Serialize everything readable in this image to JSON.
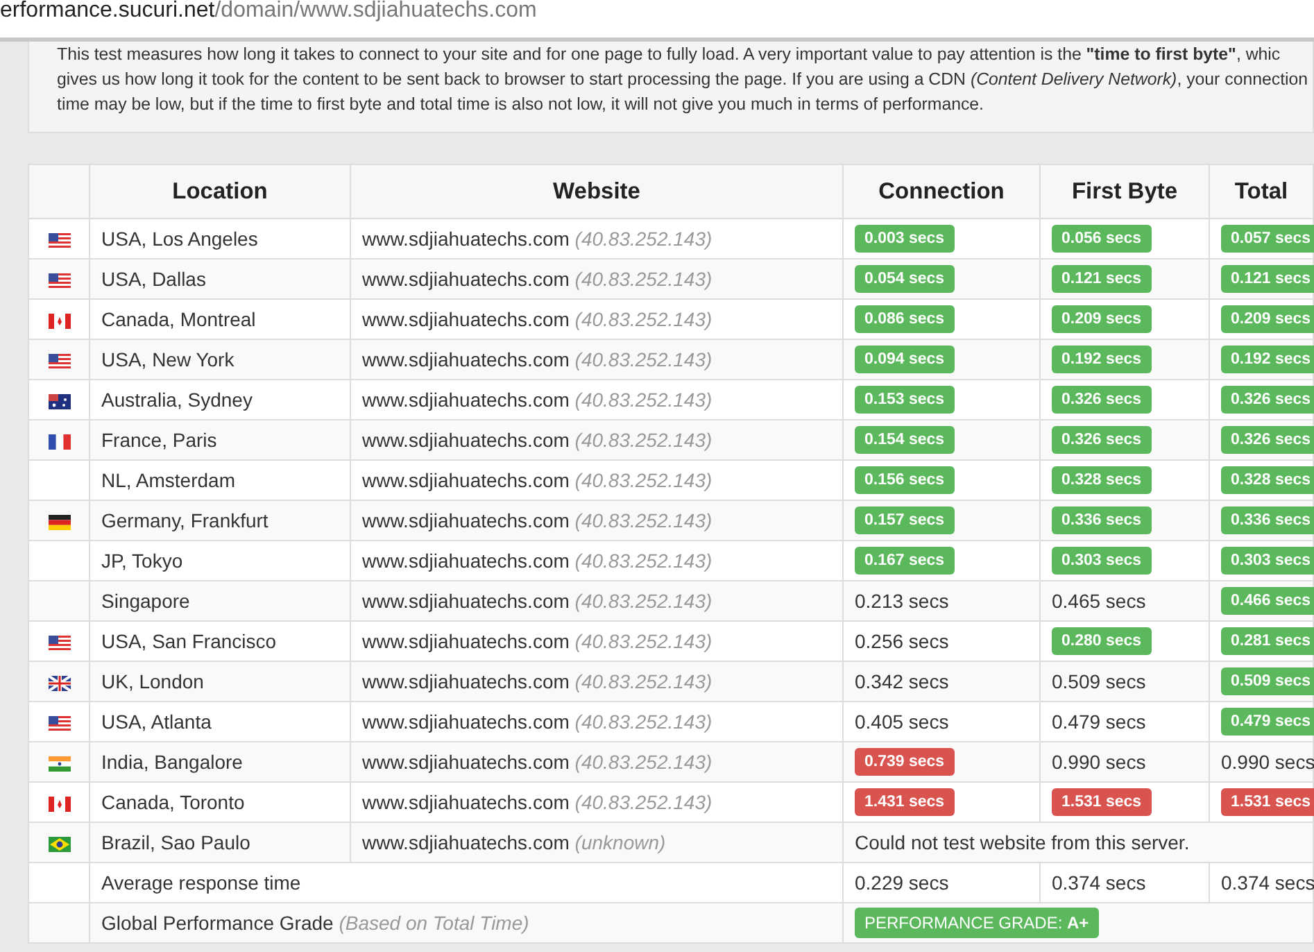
{
  "address_bar": {
    "host": "erformance.sucuri.net",
    "path": "/domain/www.sdjiahuatechs.com"
  },
  "description": "This test measures how long it takes to connect to your site and for one page to fully load. A very important value to pay attention is the **\"time to first byte\"**, whic gives us how long it took for the content to be sent back to browser to start processing the page. If you are using a CDN *(Content Delivery Network)*, your connection time may be low, but if the time to first byte and total time is also not low, it will not give you much in terms of performance.",
  "table": {
    "columns": [
      "Location",
      "Website",
      "Connection",
      "First Byte",
      "Total"
    ],
    "rows": [
      {
        "flag": {
          "kind": "us"
        },
        "location": "USA, Los Angeles",
        "website": "www.sdjiahuatechs.com",
        "ip": "(40.83.252.143)",
        "times": [
          {
            "value": "0.003 secs",
            "kind": "good"
          },
          {
            "value": "0.056 secs",
            "kind": "good"
          },
          {
            "value": "0.057 secs",
            "kind": "good"
          }
        ]
      },
      {
        "flag": {
          "kind": "us"
        },
        "location": "USA, Dallas",
        "website": "www.sdjiahuatechs.com",
        "ip": "(40.83.252.143)",
        "times": [
          {
            "value": "0.054 secs",
            "kind": "good"
          },
          {
            "value": "0.121 secs",
            "kind": "good"
          },
          {
            "value": "0.121 secs",
            "kind": "good"
          }
        ]
      },
      {
        "flag": {
          "kind": "ca"
        },
        "location": "Canada, Montreal",
        "website": "www.sdjiahuatechs.com",
        "ip": "(40.83.252.143)",
        "times": [
          {
            "value": "0.086 secs",
            "kind": "good"
          },
          {
            "value": "0.209 secs",
            "kind": "good"
          },
          {
            "value": "0.209 secs",
            "kind": "good"
          }
        ]
      },
      {
        "flag": {
          "kind": "us"
        },
        "location": "USA, New York",
        "website": "www.sdjiahuatechs.com",
        "ip": "(40.83.252.143)",
        "times": [
          {
            "value": "0.094 secs",
            "kind": "good"
          },
          {
            "value": "0.192 secs",
            "kind": "good"
          },
          {
            "value": "0.192 secs",
            "kind": "good"
          }
        ]
      },
      {
        "flag": {
          "kind": "au"
        },
        "location": "Australia, Sydney",
        "website": "www.sdjiahuatechs.com",
        "ip": "(40.83.252.143)",
        "times": [
          {
            "value": "0.153 secs",
            "kind": "good"
          },
          {
            "value": "0.326 secs",
            "kind": "good"
          },
          {
            "value": "0.326 secs",
            "kind": "good"
          }
        ]
      },
      {
        "flag": {
          "kind": "fr"
        },
        "location": "France, Paris",
        "website": "www.sdjiahuatechs.com",
        "ip": "(40.83.252.143)",
        "times": [
          {
            "value": "0.154 secs",
            "kind": "good"
          },
          {
            "value": "0.326 secs",
            "kind": "good"
          },
          {
            "value": "0.326 secs",
            "kind": "good"
          }
        ]
      },
      {
        "location": "NL, Amsterdam",
        "website": "www.sdjiahuatechs.com",
        "ip": "(40.83.252.143)",
        "times": [
          {
            "value": "0.156 secs",
            "kind": "good"
          },
          {
            "value": "0.328 secs",
            "kind": "good"
          },
          {
            "value": "0.328 secs",
            "kind": "good"
          }
        ]
      },
      {
        "flag": {
          "kind": "de"
        },
        "location": "Germany, Frankfurt",
        "website": "www.sdjiahuatechs.com",
        "ip": "(40.83.252.143)",
        "times": [
          {
            "value": "0.157 secs",
            "kind": "good"
          },
          {
            "value": "0.336 secs",
            "kind": "good"
          },
          {
            "value": "0.336 secs",
            "kind": "good"
          }
        ]
      },
      {
        "location": "JP, Tokyo",
        "website": "www.sdjiahuatechs.com",
        "ip": "(40.83.252.143)",
        "times": [
          {
            "value": "0.167 secs",
            "kind": "good"
          },
          {
            "value": "0.303 secs",
            "kind": "good"
          },
          {
            "value": "0.303 secs",
            "kind": "good"
          }
        ]
      },
      {
        "location": "Singapore",
        "website": "www.sdjiahuatechs.com",
        "ip": "(40.83.252.143)",
        "times": [
          {
            "value": "0.213 secs",
            "kind": "plain"
          },
          {
            "value": "0.465 secs",
            "kind": "plain"
          },
          {
            "value": "0.466 secs",
            "kind": "good"
          }
        ]
      },
      {
        "flag": {
          "kind": "us"
        },
        "location": "USA, San Francisco",
        "website": "www.sdjiahuatechs.com",
        "ip": "(40.83.252.143)",
        "times": [
          {
            "value": "0.256 secs",
            "kind": "plain"
          },
          {
            "value": "0.280 secs",
            "kind": "good"
          },
          {
            "value": "0.281 secs",
            "kind": "good"
          }
        ]
      },
      {
        "flag": {
          "kind": "gb"
        },
        "location": "UK, London",
        "website": "www.sdjiahuatechs.com",
        "ip": "(40.83.252.143)",
        "times": [
          {
            "value": "0.342 secs",
            "kind": "plain"
          },
          {
            "value": "0.509 secs",
            "kind": "plain"
          },
          {
            "value": "0.509 secs",
            "kind": "good"
          }
        ]
      },
      {
        "flag": {
          "kind": "us"
        },
        "location": "USA, Atlanta",
        "website": "www.sdjiahuatechs.com",
        "ip": "(40.83.252.143)",
        "times": [
          {
            "value": "0.405 secs",
            "kind": "plain"
          },
          {
            "value": "0.479 secs",
            "kind": "plain"
          },
          {
            "value": "0.479 secs",
            "kind": "good"
          }
        ]
      },
      {
        "flag": {
          "kind": "in"
        },
        "location": "India, Bangalore",
        "website": "www.sdjiahuatechs.com",
        "ip": "(40.83.252.143)",
        "times": [
          {
            "value": "0.739 secs",
            "kind": "bad"
          },
          {
            "value": "0.990 secs",
            "kind": "plain"
          },
          {
            "value": "0.990 secs",
            "kind": "plain"
          }
        ]
      },
      {
        "flag": {
          "kind": "ca"
        },
        "location": "Canada, Toronto",
        "website": "www.sdjiahuatechs.com",
        "ip": "(40.83.252.143)",
        "times": [
          {
            "value": "1.431 secs",
            "kind": "bad"
          },
          {
            "value": "1.531 secs",
            "kind": "bad"
          },
          {
            "value": "1.531 secs",
            "kind": "bad"
          }
        ]
      },
      {
        "flag": {
          "kind": "br"
        },
        "location": "Brazil, Sao Paulo",
        "website": "www.sdjiahuatechs.com",
        "ip": "(unknown)",
        "error": "Could not test website from this server."
      }
    ],
    "average": {
      "label": "Average response time",
      "times": [
        "0.229 secs",
        "0.374 secs",
        "0.374 secs"
      ]
    },
    "grade": {
      "label": "Global Performance Grade",
      "note": "(Based on Total Time)",
      "badge_label": "PERFORMANCE GRADE:",
      "badge_value": "A+"
    }
  }
}
